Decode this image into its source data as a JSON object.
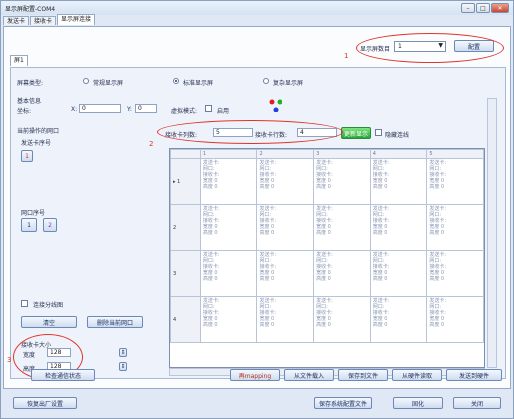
{
  "window": {
    "title": "显示屏配置-COM4",
    "min": "–",
    "max": "□",
    "close": "✕"
  },
  "top_tabs": [
    "发送卡",
    "接收卡",
    "显示屏连接"
  ],
  "screen_count": {
    "label": "显示屏数目",
    "value": "1",
    "button": "配置",
    "marker": "1"
  },
  "screen_tab": "屏1",
  "screen_type": {
    "label": "屏幕类型:",
    "options": [
      "常规显示屏",
      "标准显示屏",
      "复杂显示屏"
    ],
    "selected": 1
  },
  "basic": {
    "label": "基本信息",
    "coord_label": "坐标:",
    "x_label": "X:",
    "x_value": "0",
    "y_label": "Y:",
    "y_value": "0",
    "virtual_label": "虚拟模式:",
    "virtual_check": "启用"
  },
  "current_port": {
    "label": "当前操作的网口",
    "send_card_label": "发送卡序号",
    "send_card_value": "1",
    "net_port_label": "网口序号",
    "net_port_values": [
      "1",
      "2"
    ]
  },
  "grid_controls": {
    "cols_label": "接收卡列数:",
    "cols_value": "5",
    "rows_label": "接收卡行数:",
    "rows_value": "4",
    "update_button": "更新显示",
    "chk_label": "隐藏连线",
    "marker": "2"
  },
  "grid": {
    "columns": [
      "1",
      "2",
      "3",
      "4",
      "5"
    ],
    "rows": [
      "1",
      "2",
      "3",
      "4"
    ],
    "cell_lines": [
      "发送卡:",
      "网口:",
      "接收卡:",
      "宽度 0",
      "高度 0"
    ]
  },
  "left_panel": {
    "chk_label": "连接分线图",
    "btn_clear": "清空",
    "btn_delete": "删除当前网口",
    "recv_size_label": "接收卡大小",
    "width_label": "宽度",
    "width_value": "128",
    "height_label": "高度",
    "height_value": "128",
    "marker": "3"
  },
  "bottom": {
    "btn_check": "检查通信状态",
    "btn_mapping": "再mapping",
    "btn_load": "从文件载入",
    "btn_save": "保存到文件",
    "btn_read": "从硬件读取",
    "btn_send": "发送到硬件",
    "btn_factory": "恢复出厂设置",
    "btn_save_sys": "保存系统配置文件",
    "btn_close": "关闭",
    "btn_apply": "固化"
  }
}
